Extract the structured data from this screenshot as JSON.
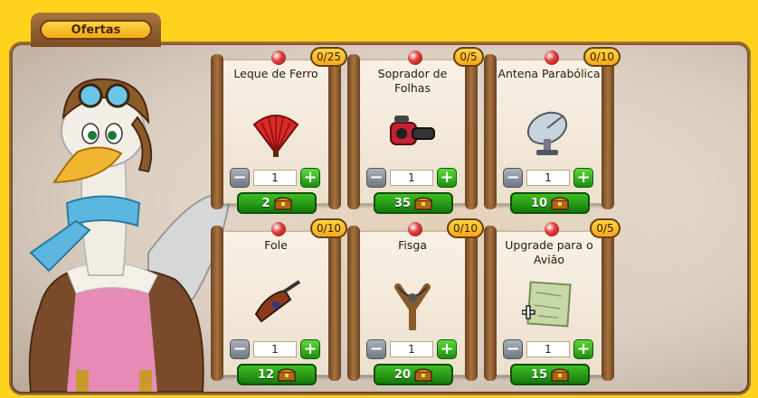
{
  "header": {
    "tab_label": "Ofertas"
  },
  "offers": [
    {
      "title": "Leque de Ferro",
      "badge": "0/25",
      "qty": "1",
      "price": "2",
      "icon": "red-fan-icon"
    },
    {
      "title": "Soprador de Folhas",
      "badge": "0/5",
      "qty": "1",
      "price": "35",
      "icon": "leaf-blower-icon"
    },
    {
      "title": "Antena Parabólica",
      "badge": "0/10",
      "qty": "1",
      "price": "10",
      "icon": "satellite-dish-icon"
    },
    {
      "title": "Fole",
      "badge": "0/10",
      "qty": "1",
      "price": "12",
      "icon": "bellows-icon"
    },
    {
      "title": "Fisga",
      "badge": "0/10",
      "qty": "1",
      "price": "20",
      "icon": "slingshot-icon"
    },
    {
      "title": "Upgrade para o Avião",
      "badge": "0/5",
      "qty": "1",
      "price": "15",
      "icon": "blueprint-upgrade-icon"
    }
  ],
  "colors": {
    "background": "#ffd21e",
    "frame": "#7b4d22",
    "plus_button": "#1c8d0f",
    "minus_button": "#6f7882",
    "price_button": "#137a0c",
    "badge": "#f2a81b"
  }
}
